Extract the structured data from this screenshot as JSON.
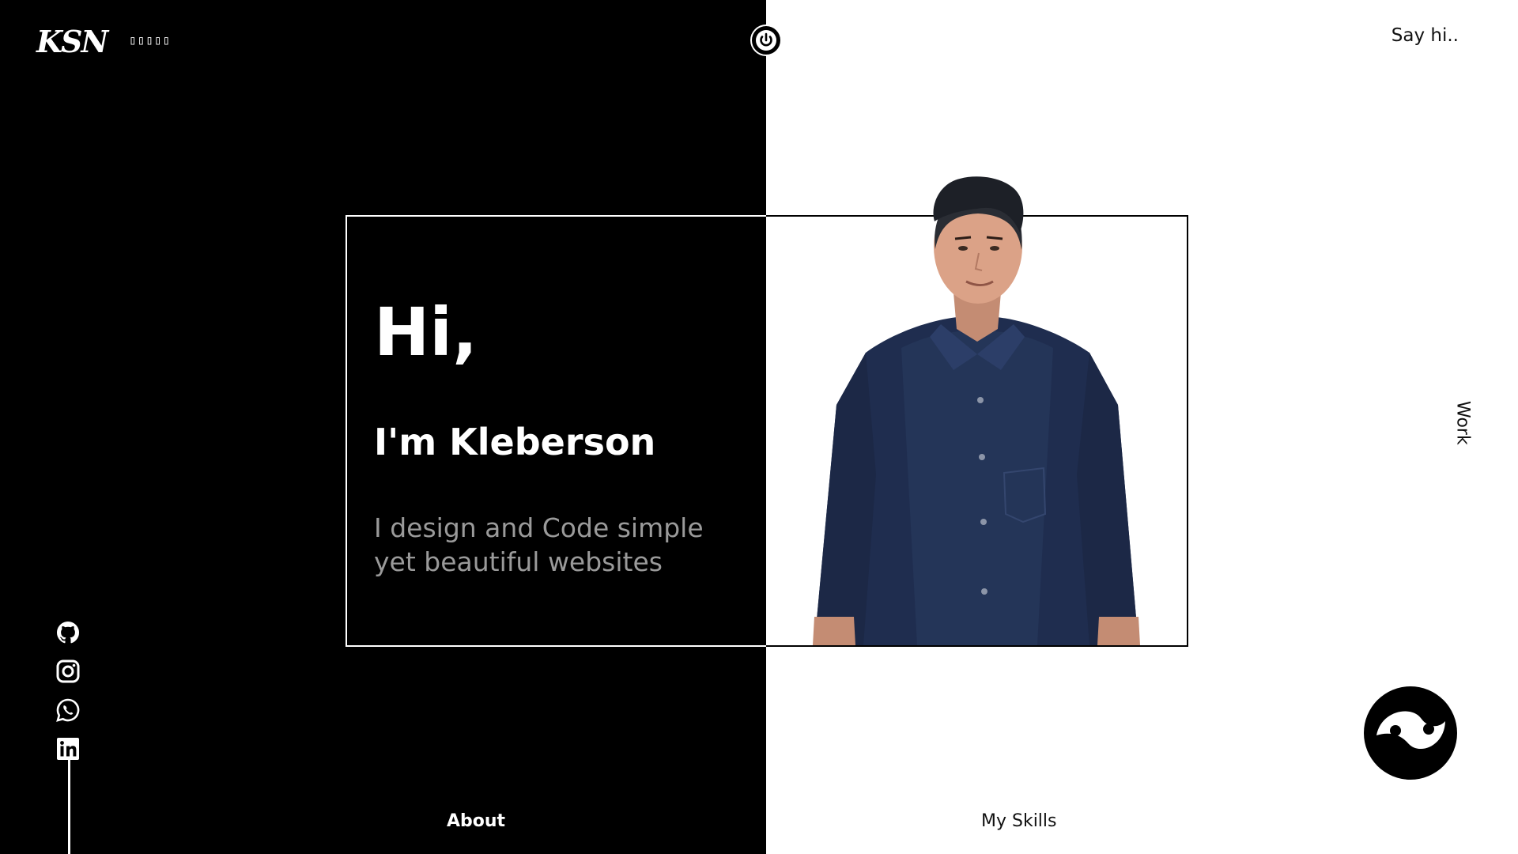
{
  "header": {
    "logo_text": "KSN",
    "logo_subtext": "▯▯▯▯▯",
    "power_icon": "power-icon",
    "say_hi_label": "Say hi.."
  },
  "hero": {
    "greeting": "Hi,",
    "name": "I'm Kleberson",
    "tagline": "I design and Code simple yet beautiful websites"
  },
  "side_nav": {
    "work_label": "Work"
  },
  "social": {
    "items": [
      {
        "icon": "github-icon"
      },
      {
        "icon": "instagram-icon"
      },
      {
        "icon": "whatsapp-icon"
      },
      {
        "icon": "linkedin-icon"
      }
    ]
  },
  "bottom_nav": {
    "about_label": "About",
    "skills_label": "My Skills"
  },
  "theme_toggle": {
    "icon": "yin-yang-icon"
  },
  "colors": {
    "dark": "#000000",
    "light": "#ffffff",
    "muted": "#9a9a9a"
  }
}
